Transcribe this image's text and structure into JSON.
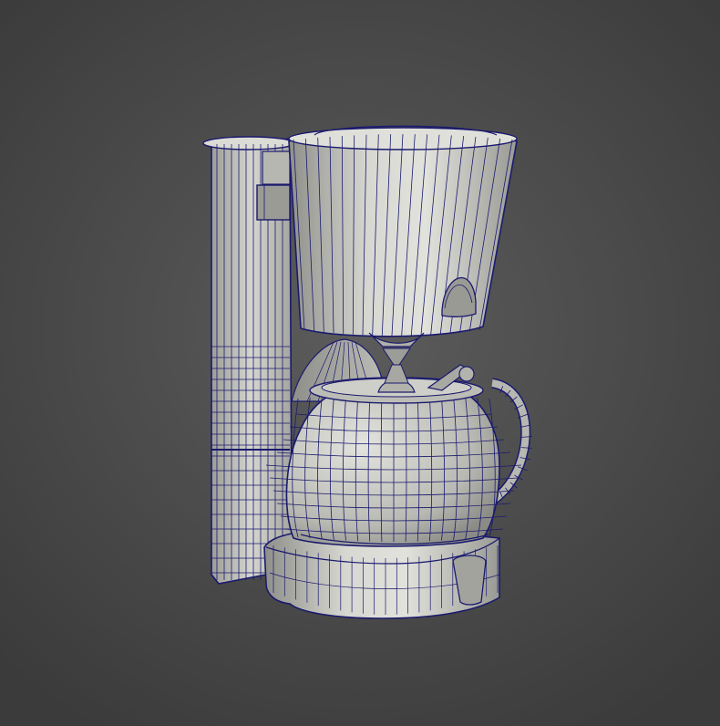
{
  "scene": {
    "subject": "coffee-maker-wireframe-model",
    "colors": {
      "background_center": "#5c5c5c",
      "background_edge": "#3b3b3b",
      "surface": "#c8c8c2",
      "surface_shade": "#8f8f8a",
      "surface_light": "#e2e2dc",
      "wire": "#1a1a6e"
    }
  }
}
